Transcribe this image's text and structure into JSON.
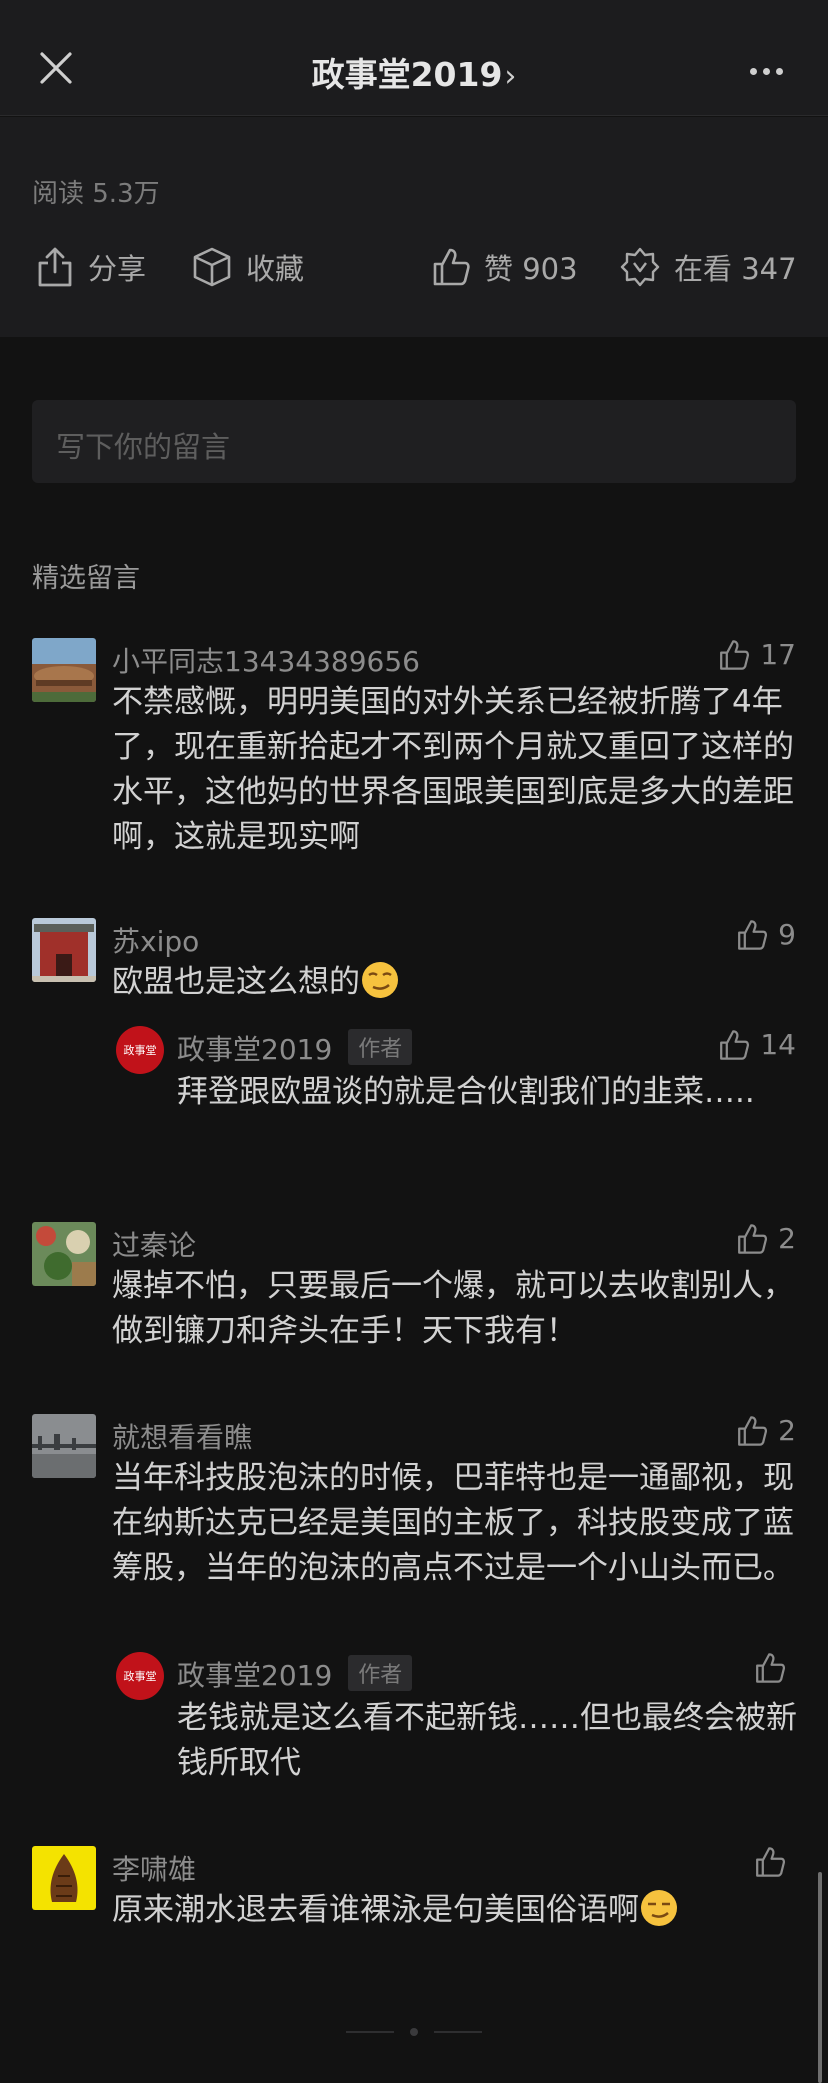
{
  "header": {
    "title": "政事堂2019",
    "chevron": "›"
  },
  "stats": {
    "reads": "阅读 5.3万",
    "share_label": "分享",
    "favorite_label": "收藏",
    "like_label": "赞 903",
    "watching_label": "在看 347"
  },
  "comment_input": {
    "placeholder": "写下你的留言"
  },
  "section_title": "精选留言",
  "comments": [
    {
      "name": "小平同志13434389656",
      "likes": "17",
      "text": "不禁感慨，明明美国的对外关系已经被折腾了4年了，现在重新拾起才不到两个月就又重回了这样的水平，这他妈的世界各国跟美国到底是多大的差距啊，这就是现实啊"
    },
    {
      "name": "苏xipo",
      "likes": "9",
      "text": "欧盟也是这么想的",
      "emoji": "smirk-emoji",
      "reply": {
        "name": "政事堂2019",
        "badge": "作者",
        "likes": "14",
        "text": "拜登跟欧盟谈的就是合伙割我们的韭菜….."
      }
    },
    {
      "name": "过秦论",
      "likes": "2",
      "text": "爆掉不怕，只要最后一个爆，就可以去收割别人，做到镰刀和斧头在手！天下我有！"
    },
    {
      "name": "就想看看瞧",
      "likes": "2",
      "text": "当年科技股泡沫的时候，巴菲特也是一通鄙视，现在纳斯达克已经是美国的主板了，科技股变成了蓝筹股，当年的泡沫的高点不过是一个小山头而已。",
      "reply": {
        "name": "政事堂2019",
        "badge": "作者",
        "likes": "",
        "text": "老钱就是这么看不起新钱……但也最终会被新钱所取代"
      }
    },
    {
      "name": "李啸雄",
      "likes": "",
      "text": "原来潮水退去看谁裸泳是句美国俗语啊",
      "emoji": "smirk-emoji"
    }
  ],
  "avatar_logo_text": "政事堂"
}
